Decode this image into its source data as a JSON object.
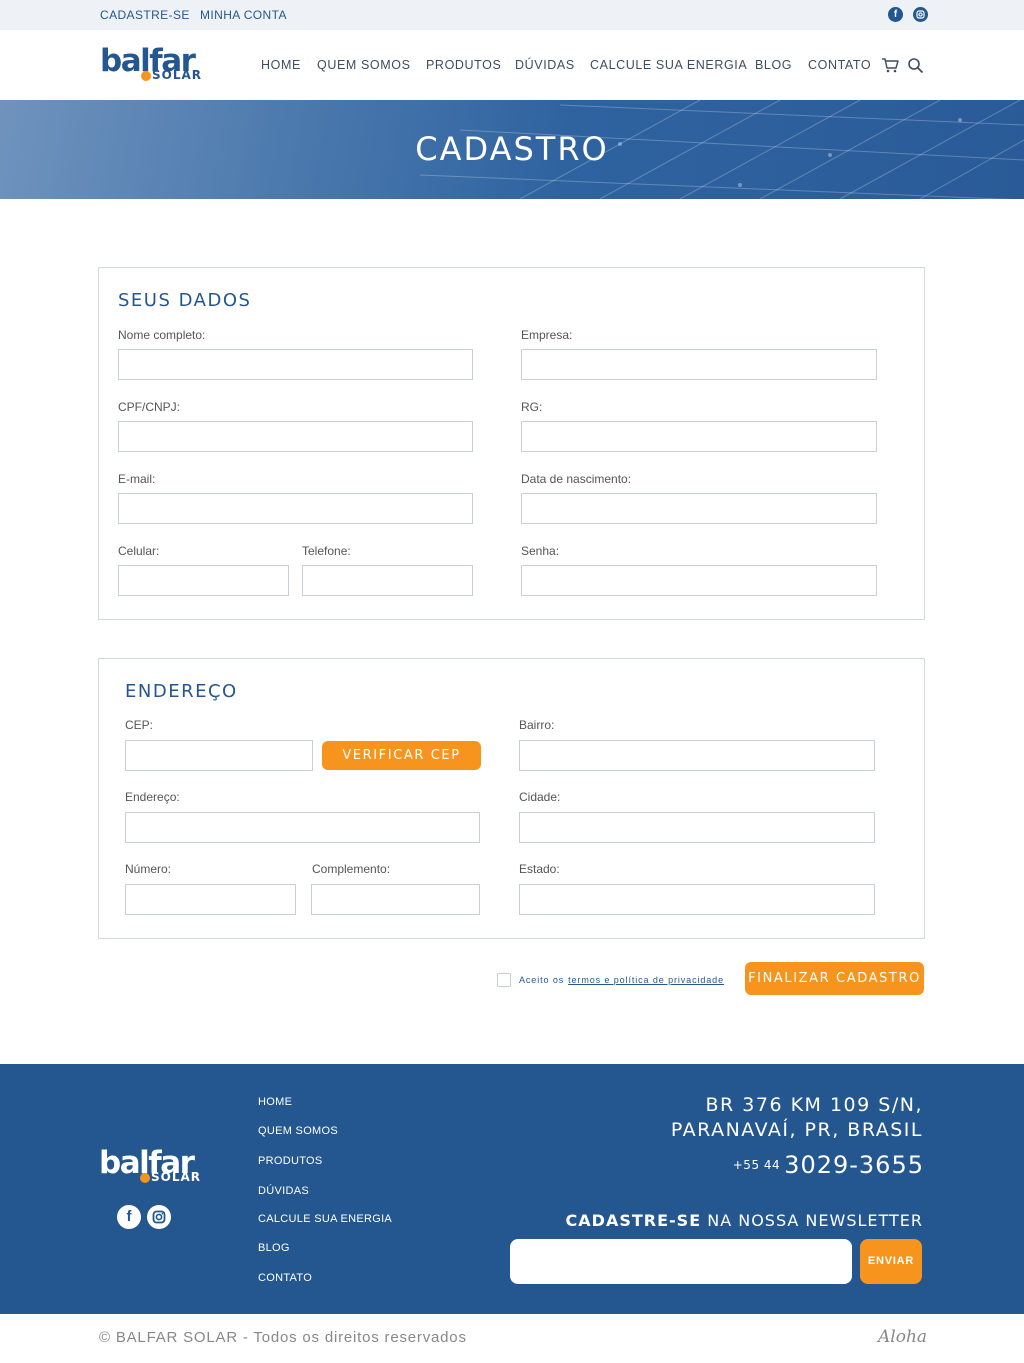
{
  "topbar": {
    "links": [
      "CADASTRE-SE",
      "MINHA CONTA"
    ],
    "social_icons": [
      "facebook-icon",
      "instagram-icon"
    ]
  },
  "brand": {
    "wordmark": "balfar",
    "sub": "SOLAR"
  },
  "nav": {
    "items": [
      "HOME",
      "QUEM SOMOS",
      "PRODUTOS",
      "DÚVIDAS",
      "CALCULE SUA ENERGIA",
      "BLOG",
      "CONTATO"
    ],
    "icons": [
      "cart-icon",
      "search-icon"
    ]
  },
  "hero": {
    "title": "CADASTRO"
  },
  "seus_dados": {
    "title": "SEUS DADOS",
    "labels": {
      "nome": "Nome completo:",
      "empresa": "Empresa:",
      "cpf": "CPF/CNPJ:",
      "rg": "RG:",
      "email": "E-mail:",
      "nascimento": "Data de nascimento:",
      "celular": "Celular:",
      "telefone": "Telefone:",
      "senha": "Senha:"
    }
  },
  "endereco": {
    "title": "ENDEREÇO",
    "labels": {
      "cep": "CEP:",
      "bairro": "Bairro:",
      "endereco": "Endereço:",
      "cidade": "Cidade:",
      "numero": "Número:",
      "complemento": "Complemento:",
      "estado": "Estado:"
    },
    "verify_button": "VERIFICAR CEP"
  },
  "consent": {
    "text": "Aceito os",
    "link": "termos e política de privacidade"
  },
  "submit_button": "FINALIZAR CADASTRO",
  "footer": {
    "nav": [
      "HOME",
      "QUEM SOMOS",
      "PRODUTOS",
      "DÚVIDAS",
      "CALCULE SUA ENERGIA",
      "BLOG",
      "CONTATO"
    ],
    "address_line1": "BR 376 KM 109 S/N,",
    "address_line2": "PARANAVAÍ, PR,  BRASIL",
    "phone_prefix": "+55 44",
    "phone_number": "3029-3655",
    "newsletter_bold": "CADASTRE-SE",
    "newsletter_rest": "NA NOSSA NEWSLETTER",
    "newsletter_button": "ENVIAR"
  },
  "copyright": "© BALFAR SOLAR - Todos os direitos reservados",
  "credit": "Aloha",
  "colors": {
    "brand_blue": "#24578f",
    "accent_orange": "#f7941d",
    "topbar_bg": "#eef2f7"
  }
}
